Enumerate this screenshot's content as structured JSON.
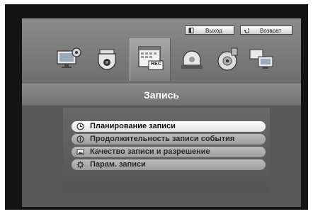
{
  "header": {
    "exit_label": "Выход",
    "back_label": "Возврат",
    "exit_icon": "exit-door-icon",
    "back_icon": "return-arrow-icon"
  },
  "main_icons": [
    {
      "name": "monitor-settings-icon"
    },
    {
      "name": "camera-icon"
    },
    {
      "name": "record-calendar-icon",
      "badge": "REC",
      "selected": true
    },
    {
      "name": "alarm-icon"
    },
    {
      "name": "backup-disc-icon"
    },
    {
      "name": "network-icon"
    }
  ],
  "title": "Запись",
  "menu": {
    "items": [
      {
        "label": "Планирование записи",
        "icon": "clock-icon",
        "selected": true
      },
      {
        "label": "Продолжительность записи события",
        "icon": "event-icon"
      },
      {
        "label": "Качество записи и разрешение",
        "icon": "image-icon"
      },
      {
        "label": "Парам. записи",
        "icon": "gear-icon"
      }
    ]
  },
  "colors": {
    "frame": "#141414",
    "background": "#585858",
    "selected_item": "#ffffff",
    "item": "#b0b0b0",
    "title_text": "#ffffff"
  }
}
